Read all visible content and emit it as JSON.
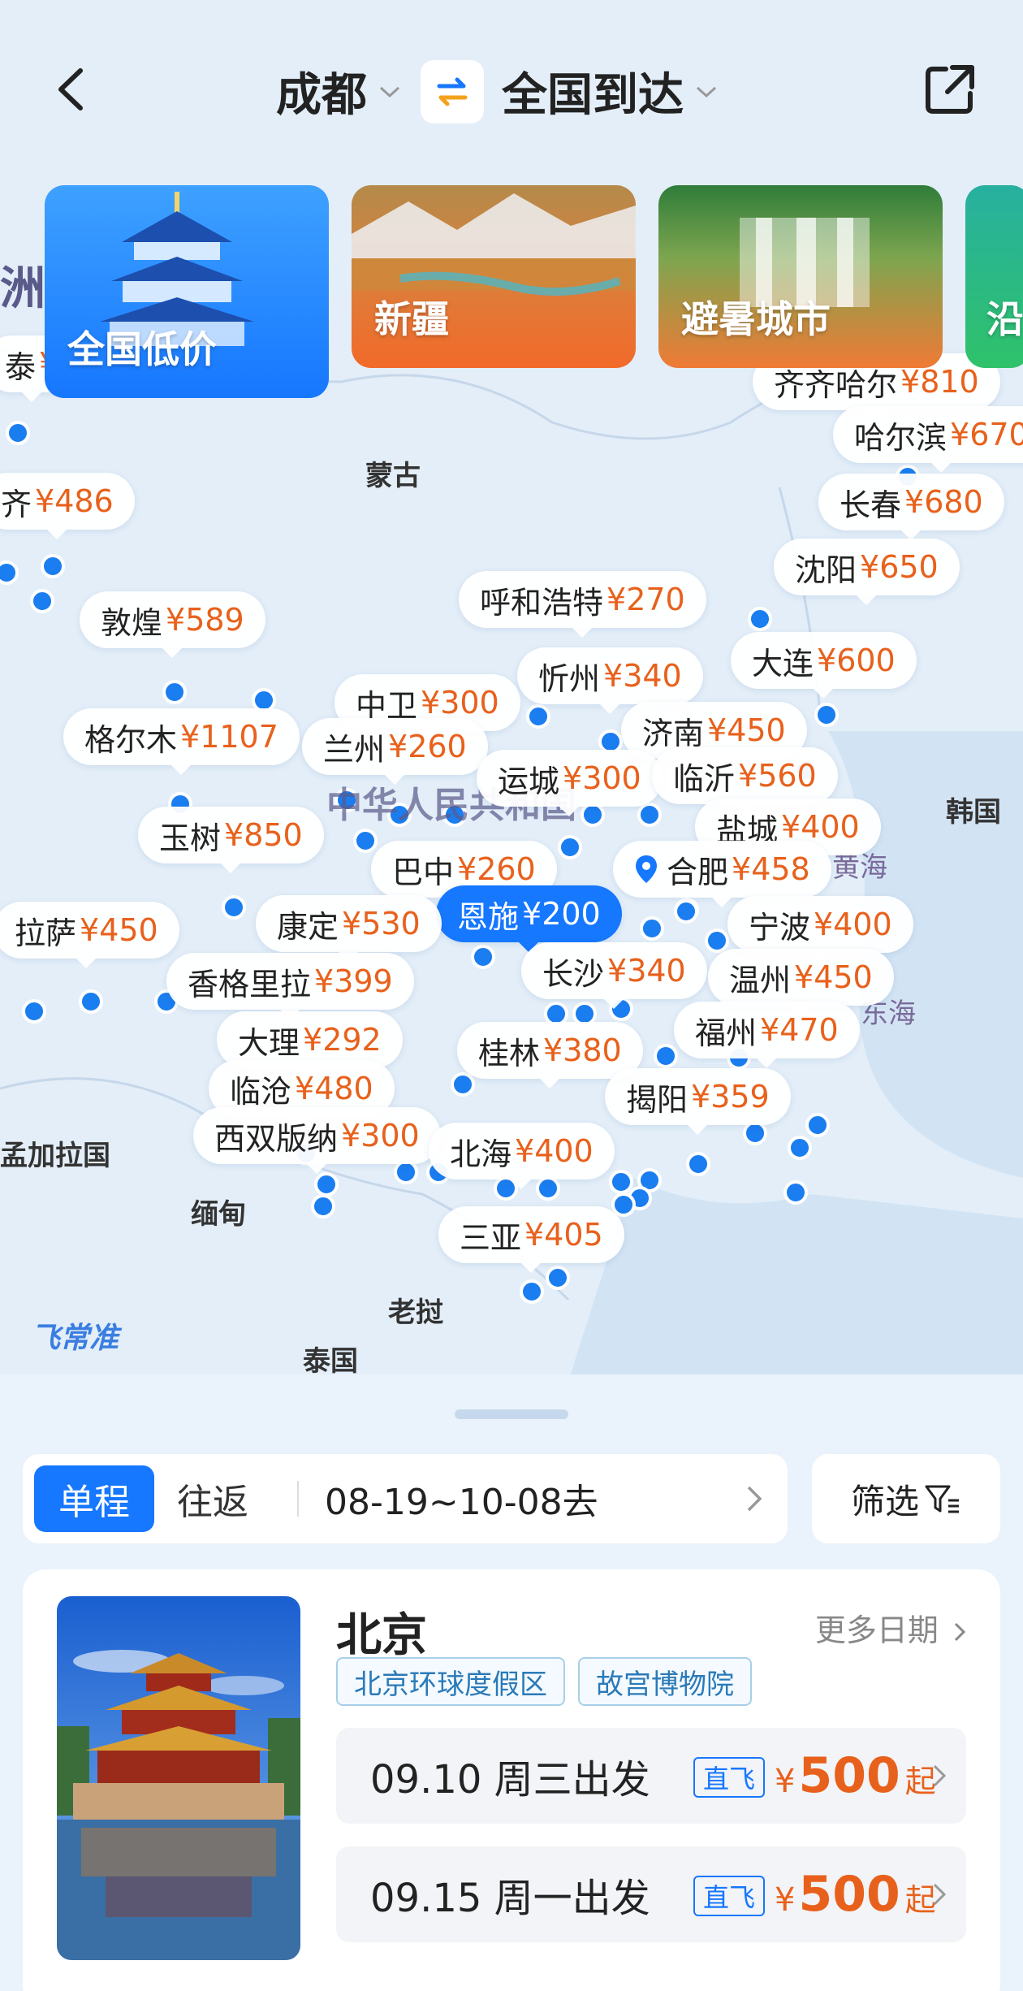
{
  "header": {
    "from_city": "成都",
    "to_city": "全国到达"
  },
  "categories": [
    {
      "label": "全国低价"
    },
    {
      "label": "新疆"
    },
    {
      "label": "避暑城市"
    },
    {
      "label": "沿"
    }
  ],
  "map": {
    "watermark": "飞常准",
    "region_labels": {
      "mongolia": "蒙古",
      "korea": "韩国",
      "bangladesh": "孟加拉国",
      "myanmar": "缅甸",
      "laos": "老挝",
      "thailand": "泰国",
      "continent_fragment": "洲",
      "china": "中华人民共和国",
      "yellow_sea": "黄海",
      "east_sea": "东海"
    },
    "pins": [
      {
        "name": "泰",
        "price": "¥"
      },
      {
        "name": "齐齐哈尔",
        "price": "¥810"
      },
      {
        "name": "哈尔滨",
        "price": "¥670"
      },
      {
        "name": "齐",
        "price": "¥486"
      },
      {
        "name": "长春",
        "price": "¥680"
      },
      {
        "name": "沈阳",
        "price": "¥650"
      },
      {
        "name": "呼和浩特",
        "price": "¥270"
      },
      {
        "name": "敦煌",
        "price": "¥589"
      },
      {
        "name": "大连",
        "price": "¥600"
      },
      {
        "name": "忻州",
        "price": "¥340"
      },
      {
        "name": "中卫",
        "price": "¥300"
      },
      {
        "name": "格尔木",
        "price": "¥1107"
      },
      {
        "name": "兰州",
        "price": "¥260"
      },
      {
        "name": "济南",
        "price": "¥450"
      },
      {
        "name": "运城",
        "price": "¥300"
      },
      {
        "name": "临沂",
        "price": "¥560"
      },
      {
        "name": "玉树",
        "price": "¥850"
      },
      {
        "name": "盐城",
        "price": "¥400"
      },
      {
        "name": "巴中",
        "price": "¥260"
      },
      {
        "name": "合肥",
        "price": "¥458"
      },
      {
        "name": "恩施",
        "price": "¥200"
      },
      {
        "name": "拉萨",
        "price": "¥450"
      },
      {
        "name": "康定",
        "price": "¥530"
      },
      {
        "name": "宁波",
        "price": "¥400"
      },
      {
        "name": "长沙",
        "price": "¥340"
      },
      {
        "name": "温州",
        "price": "¥450"
      },
      {
        "name": "香格里拉",
        "price": "¥399"
      },
      {
        "name": "福州",
        "price": "¥470"
      },
      {
        "name": "大理",
        "price": "¥292"
      },
      {
        "name": "桂林",
        "price": "¥380"
      },
      {
        "name": "临沧",
        "price": "¥480"
      },
      {
        "name": "揭阳",
        "price": "¥359"
      },
      {
        "name": "西双版纳",
        "price": "¥300"
      },
      {
        "name": "北海",
        "price": "¥400"
      },
      {
        "name": "三亚",
        "price": "¥405"
      }
    ]
  },
  "filters": {
    "one_way": "单程",
    "round_trip": "往返",
    "date_range": "08-19~10-08去",
    "filter_label": "筛选"
  },
  "destination": {
    "name": "北京",
    "more_dates": "更多日期",
    "tags": [
      "北京环球度假区",
      "故宫博物院"
    ],
    "flights": [
      {
        "date": "09.10 周三出发",
        "direct": "直飞",
        "currency": "¥",
        "price": "500",
        "suffix": "起"
      },
      {
        "date": "09.15 周一出发",
        "direct": "直飞",
        "currency": "¥",
        "price": "500",
        "suffix": "起"
      }
    ]
  },
  "colors": {
    "accent": "#1677ff",
    "price": "#e8611c",
    "map_land": "#e4eff9",
    "dot": "#1a7df0"
  }
}
